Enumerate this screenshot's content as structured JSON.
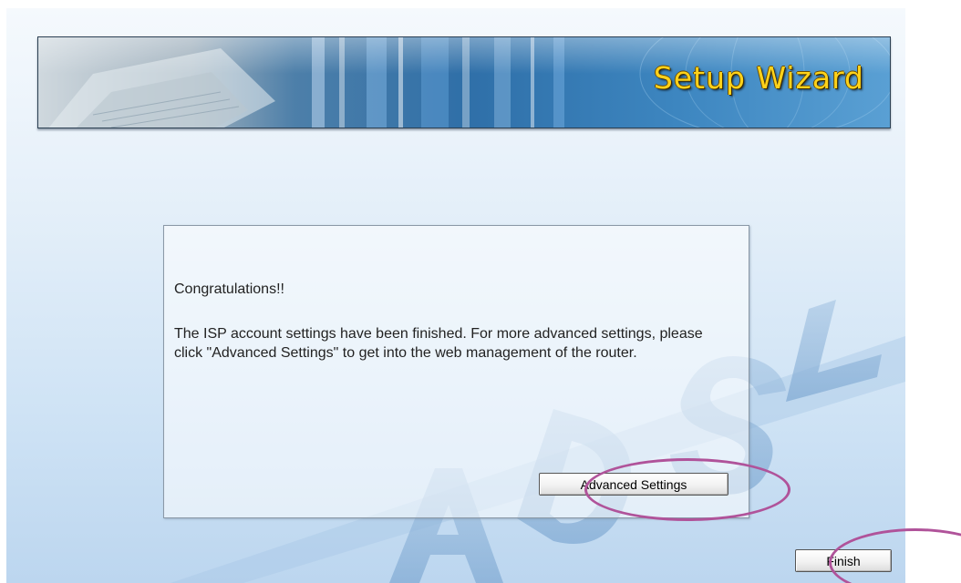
{
  "banner": {
    "title": "Setup Wizard"
  },
  "watermark": {
    "text": "ADSL"
  },
  "message": {
    "heading": "Congratulations!!",
    "body": "The ISP account settings have been finished. For more advanced settings, please click \"Advanced Settings\" to get into the web management of the router."
  },
  "buttons": {
    "advanced_settings": "Advanced Settings",
    "finish": "Finish"
  },
  "annotations": {
    "highlight_color": "#b0539a"
  },
  "colors": {
    "title_yellow": "#ffd21a",
    "banner_blue": "#2f6fa8"
  }
}
